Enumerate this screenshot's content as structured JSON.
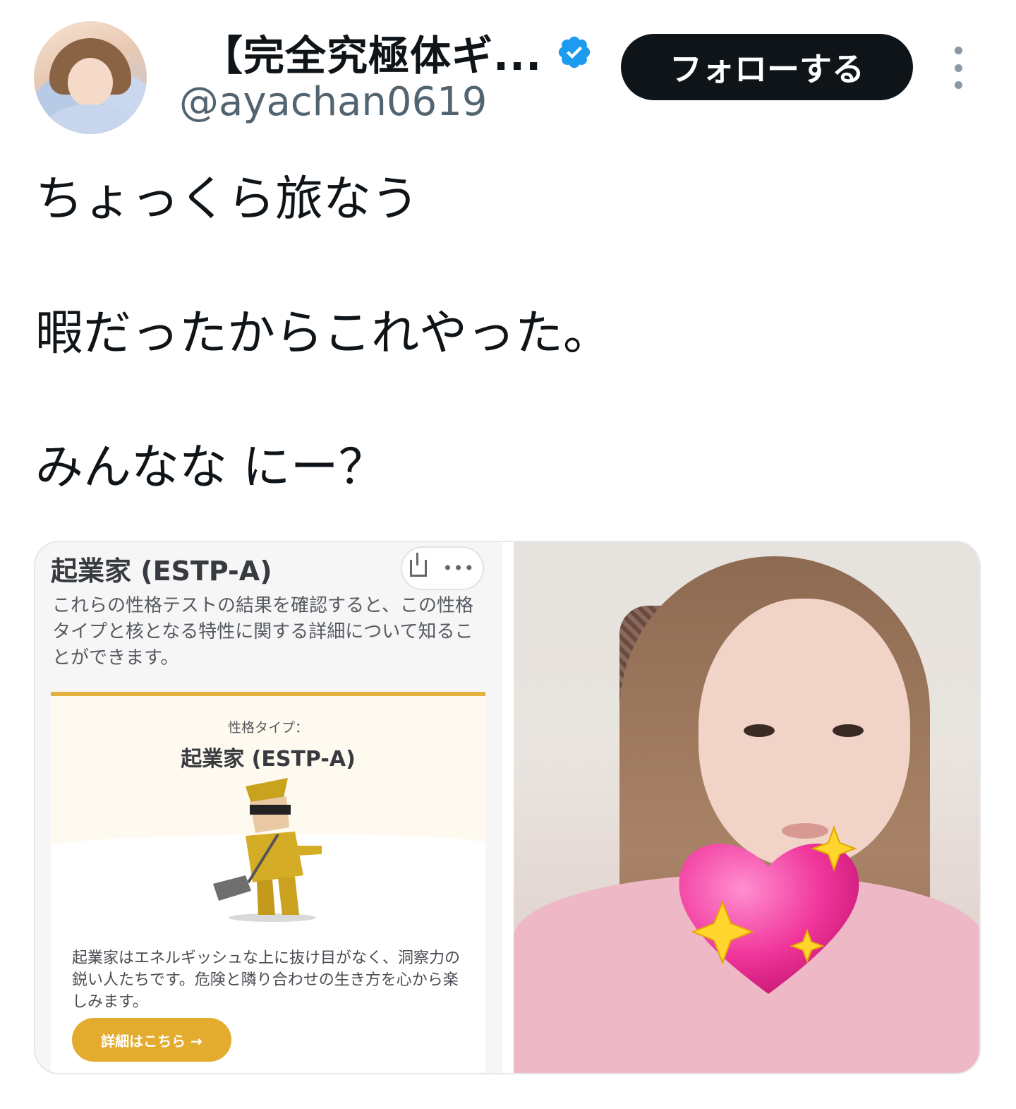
{
  "author": {
    "display_name": "【完全究極体ギ...",
    "handle": "@ayachan0619",
    "verified_icon": "verified-badge-icon",
    "verified_color": "#1d9bf0"
  },
  "actions": {
    "follow_label": "フォローする",
    "more_icon": "more-vertical-icon"
  },
  "tweet": {
    "lines": [
      "ちょっくら旅なう",
      "暇だったからこれやった。",
      "みんなな にー？"
    ]
  },
  "media": {
    "left_card": {
      "title": "起業家 (ESTP-A)",
      "description": "これらの性格テストの結果を確認すると、この性格タイプと核となる特性に関する詳細について知ることができます。",
      "share_icon": "share-icon",
      "dots_icon": "more-horizontal-icon",
      "type_label": "性格タイプ：",
      "type_title": "起業家 (ESTP-A)",
      "type_text": "起業家はエネルギッシュな上に抜け目がなく、洞察力の鋭い人たちです。危険と隣り合わせの生き方を心から楽しみます。",
      "details_button": "詳細はこちら →",
      "accent_color": "#e3ac2f"
    },
    "right_photo": {
      "description_icon": "selfie-photo"
    }
  }
}
